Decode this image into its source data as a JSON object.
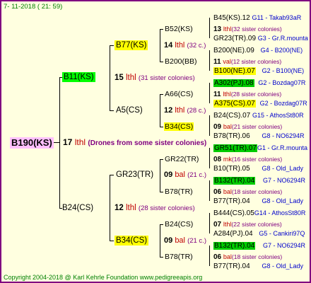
{
  "header": "7- 11-2018 ( 21: 59)",
  "footer": "Copyright 2004-2018 @ Karl Kehrle Foundation    www.pedigreeapis.org",
  "root": {
    "id": "B190(KS)",
    "num": "17",
    "word": "lthl",
    "note": "(Drones from some sister colonies)"
  },
  "gen1": [
    {
      "id": "B11(KS)",
      "num": "15",
      "word": "lthl",
      "note": "(31 sister colonies)"
    },
    {
      "id": "B24(CS)",
      "num": "12",
      "word": "lthl",
      "note": "(28 sister colonies)"
    }
  ],
  "gen2": [
    {
      "id": "B77(KS)",
      "num": "14",
      "word": "lthl",
      "note": "(32 c.)"
    },
    {
      "id": "A5(CS)",
      "num": "12",
      "word": "lthl",
      "note": "(28 c.)"
    },
    {
      "id": "GR23(TR)",
      "num": "09",
      "word": "bal",
      "note": "(21 c.)"
    },
    {
      "id": "B34(CS)",
      "num": "09",
      "word": "bal",
      "note": "(21 c.)"
    }
  ],
  "gen3": [
    {
      "id": "B52(KS)",
      "num": "13",
      "word": "lthl",
      "note": "(32 sister colonies)"
    },
    {
      "id": "B200(BB)",
      "num": "11",
      "word": "val",
      "note": "(12 sister colonies)"
    },
    {
      "id": "A66(CS)",
      "num": "11",
      "word": "lthl",
      "note": "(28 sister colonies)"
    },
    {
      "id": "B34(CS)",
      "num": "09",
      "word": "bal",
      "note": "(21 sister colonies)"
    },
    {
      "id": "GR22(TR)",
      "num": "08",
      "word": "mk",
      "note": "(16 sister colonies)"
    },
    {
      "id": "B78(TR)",
      "num": "06",
      "word": "bal",
      "note": "(18 sister colonies)"
    },
    {
      "id": "B24(CS)",
      "num": "07",
      "word": "lthl",
      "note": "(22 sister colonies)"
    },
    {
      "id": "B78(TR)",
      "num": "06",
      "word": "bal",
      "note": "(18 sister colonies)"
    }
  ],
  "gen4": [
    {
      "id": "B45(KS).12",
      "code": "G11 - Takab93aR"
    },
    {
      "id": "GR23(TR).09",
      "code": "G3 - Gr.R.mounta"
    },
    {
      "id": "B200(NE).09",
      "code": "G4 - B200(NE)"
    },
    {
      "id": "B100(NE).07",
      "code": "G2 - B100(NE)"
    },
    {
      "id": "A302(PJ).08",
      "code": "G2 - Bozdag07R"
    },
    {
      "id": "A375(CS).07",
      "code": "G2 - Bozdag07R"
    },
    {
      "id": "B24(CS).07",
      "code": "G15 - AthosSt80R"
    },
    {
      "id": "B78(TR).06",
      "code": "G8 - NO6294R"
    },
    {
      "id": "GR51(TR).07",
      "code": "G1 - Gr.R.mounta"
    },
    {
      "id": "B10(TR).05",
      "code": "G8 - Old_Lady"
    },
    {
      "id": "B132(TR).04",
      "code": "G7 - NO6294R"
    },
    {
      "id": "B77(TR).04",
      "code": "G8 - Old_Lady"
    },
    {
      "id": "B444(CS).05",
      "code": "G14 - AthosSt80R"
    },
    {
      "id": "A284(PJ).04",
      "code": "G5 - Cankiri97Q"
    },
    {
      "id": "B132(TR).04",
      "code": "G7 - NO6294R"
    },
    {
      "id": "B77(TR).04",
      "code": "G8 - Old_Lady"
    }
  ],
  "colors": {
    "border": "#800080",
    "background": "#ffffe0",
    "root_box": "#ffc0ff",
    "queen_box": "#ffff00",
    "bright_box": "#00ff00",
    "green_box": "#00cc00"
  }
}
